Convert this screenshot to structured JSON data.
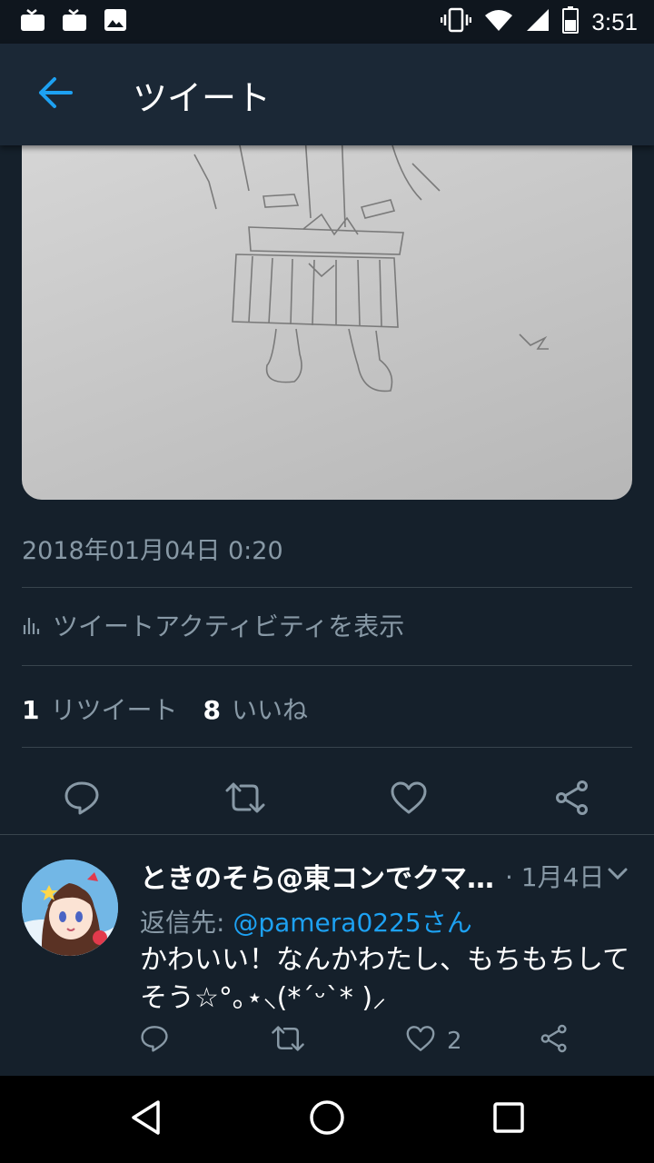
{
  "status_bar": {
    "time": "3:51",
    "icons": [
      "tv-icon",
      "tv-icon",
      "image-icon",
      "vibrate-icon",
      "wifi-icon",
      "signal-icon",
      "battery-icon"
    ]
  },
  "app_bar": {
    "title": "ツイート",
    "back_icon": "arrow-left-icon"
  },
  "tweet": {
    "timestamp": "2018年01月04日 0:20",
    "activity_label": "ツイートアクティビティを表示",
    "retweet_count": "1",
    "retweet_label": "リツイート",
    "like_count": "8",
    "like_label": "いいね",
    "actions": [
      "reply-icon",
      "retweet-icon",
      "like-icon",
      "share-icon"
    ]
  },
  "reply": {
    "name": "ときのそら@東コンでクマ…",
    "date": "· 1月4日",
    "reply_to_prefix": "返信先: ",
    "reply_to_mention": "@pamera0225さん",
    "text": "かわいい！なんかわたし、もちもちしてそう☆°｡⋆⸜(*ˊᵕˋ* )⸝",
    "like_count": "2"
  },
  "colors": {
    "background": "#15202b",
    "app_bar": "#1b2836",
    "accent": "#1da1f2",
    "secondary_text": "#8899a6",
    "divider": "#38444d"
  }
}
